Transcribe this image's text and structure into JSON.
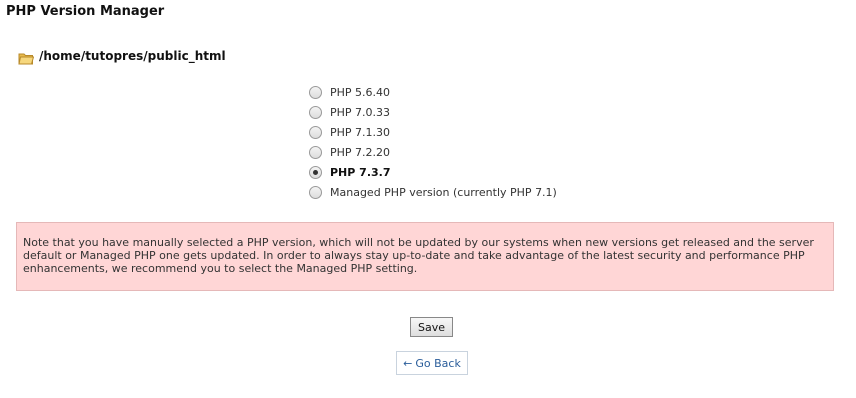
{
  "page": {
    "title": "PHP Version Manager"
  },
  "path": {
    "text": "/home/tutopres/public_html"
  },
  "versions": [
    {
      "label": "PHP 5.6.40",
      "selected": false
    },
    {
      "label": "PHP 7.0.33",
      "selected": false
    },
    {
      "label": "PHP 7.1.30",
      "selected": false
    },
    {
      "label": "PHP 7.2.20",
      "selected": false
    },
    {
      "label": "PHP 7.3.7",
      "selected": true
    },
    {
      "label": "Managed PHP version (currently PHP 7.1)",
      "selected": false
    }
  ],
  "notice": {
    "text": "Note that you have manually selected a PHP version, which will not be updated by our systems when new versions get released and the server default or Managed PHP one gets updated. In order to always stay up-to-date and take advantage of the latest security and performance PHP enhancements, we recommend you to select the Managed PHP setting."
  },
  "buttons": {
    "save": "Save",
    "back": "Go Back",
    "back_arrow": "←"
  },
  "colors": {
    "notice_bg": "#ffd6d6",
    "link": "#2a5d9a"
  }
}
